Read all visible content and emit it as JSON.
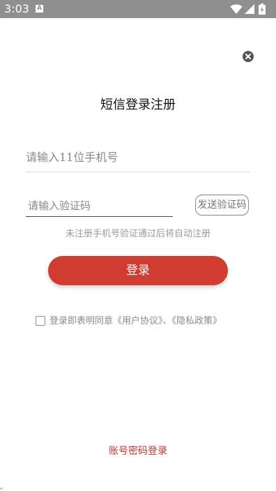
{
  "status_bar": {
    "time": "3:03",
    "notification_icon": "a-letter-icon",
    "icons": [
      "wifi-icon",
      "cellular-signal-icon",
      "battery-charging-icon"
    ]
  },
  "page": {
    "title": "短信登录注册",
    "close_icon": "close-icon"
  },
  "phone": {
    "placeholder": "请输入11位手机号"
  },
  "code": {
    "placeholder": "请输入验证码",
    "send_label": "发送验证码"
  },
  "hint": "未注册手机号验证通过后将自动注册",
  "login_label": "登录",
  "agreement": {
    "checked": false,
    "text": "登录即表明同意《用户协议》、《隐私政策》"
  },
  "account_login_label": "账号密码登录",
  "colors": {
    "accent": "#d03c2f",
    "link": "#c0392b",
    "status_bar": "#8f8f8f"
  }
}
